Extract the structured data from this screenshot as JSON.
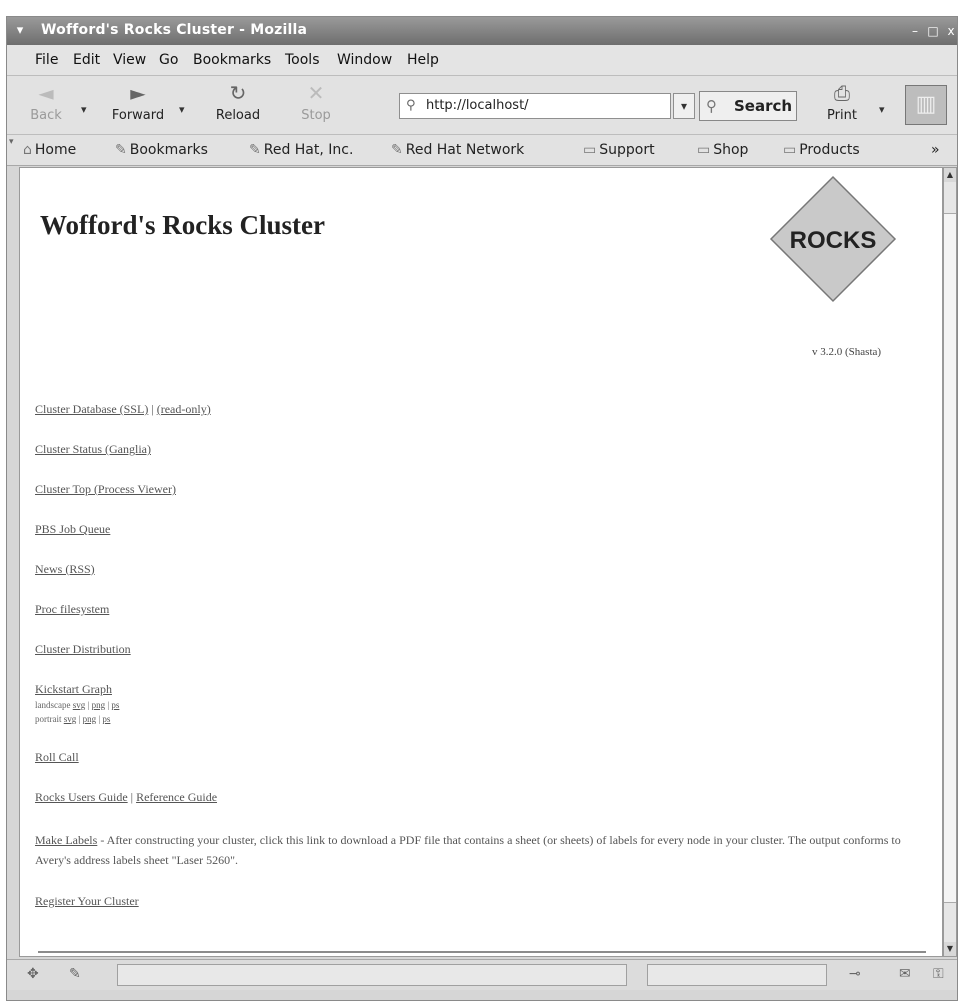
{
  "window": {
    "title": "Wofford's Rocks Cluster - Mozilla",
    "system_menu_icon": "chevron-down-icon",
    "minimize_label": "–",
    "maximize_label": "□",
    "close_label": "x"
  },
  "menubar": {
    "items": [
      "File",
      "Edit",
      "View",
      "Go",
      "Bookmarks",
      "Tools",
      "Window",
      "Help"
    ]
  },
  "navbar": {
    "back_label": "Back",
    "forward_label": "Forward",
    "reload_label": "Reload",
    "stop_label": "Stop",
    "url": "http://localhost/",
    "search_label": "Search",
    "print_label": "Print"
  },
  "personal_toolbar": {
    "items": [
      "Home",
      "Bookmarks",
      "Red Hat, Inc.",
      "Red Hat Network",
      "Support",
      "Shop",
      "Products"
    ],
    "overflow": "»"
  },
  "page": {
    "title": "Wofford's Rocks Cluster",
    "logo_text": "ROCKS",
    "version": "v 3.2.0 (Shasta)",
    "links": {
      "cluster_database": "Cluster Database (SSL)",
      "read_only": "(read-only)",
      "cluster_status": "Cluster Status (Ganglia)",
      "cluster_top": "Cluster Top (Process Viewer)",
      "pbs_queue": "PBS Job Queue",
      "news": "News (RSS)",
      "proc_fs": "Proc filesystem",
      "cluster_distribution": "Cluster Distribution",
      "kickstart_graph": "Kickstart Graph",
      "landscape_label": "landscape",
      "portrait_label": "portrait",
      "svg": "svg",
      "png": "png",
      "ps": "ps",
      "roll_call": "Roll Call",
      "rocks_users_guide": "Rocks Users Guide",
      "reference_guide": "Reference Guide",
      "make_labels": "Make Labels",
      "make_labels_desc": " - After constructing your cluster, click this link to download a PDF file that contains a sheet (or sheets) of labels for every node in your cluster. The output conforms to Avery's address labels sheet \"Laser 5260\".",
      "register_cluster": "Register Your Cluster"
    },
    "separator": " | "
  },
  "colors": {
    "titlebar": "#7a7a7a",
    "link": "#555555",
    "logo_fill": "#c9c9c9"
  }
}
